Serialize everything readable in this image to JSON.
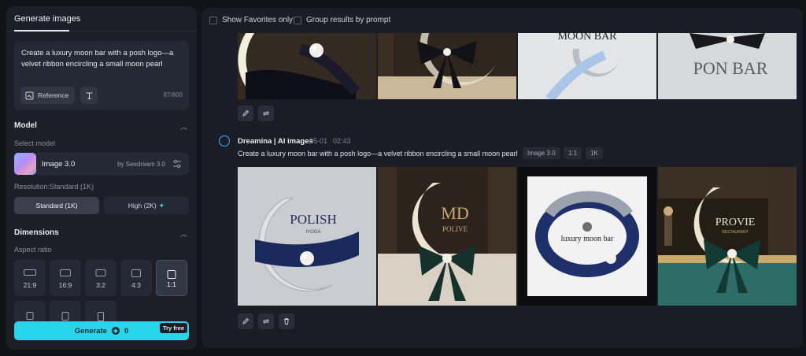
{
  "left_panel": {
    "tab_label": "Generate images",
    "prompt_text": "Create a luxury moon bar with a posh logo—a velvet ribbon encircling a small moon pearl",
    "reference_label": "Reference",
    "char_count": "87/800",
    "model_section": {
      "title": "Model",
      "select_label": "Select model",
      "model_name": "Image 3.0",
      "model_by": "by Seedream 3.0"
    },
    "resolution": {
      "label": "Resolution:Standard (1K)",
      "standard_label": "Standard (1K)",
      "high_label": "High (2K)"
    },
    "dimensions": {
      "title": "Dimensions",
      "aspect_label": "Aspect ratio",
      "ratios": [
        "21:9",
        "16:9",
        "3:2",
        "4:3",
        "1:1"
      ],
      "selected": "1:1"
    },
    "generate": {
      "label": "Generate",
      "cost": "0",
      "badge": "Try free"
    }
  },
  "right_panel": {
    "filters": {
      "favorites_label": "Show Favorites only",
      "group_label": "Group results by prompt"
    },
    "top_row_texts": {
      "moon_bar_text": "MOON BAR",
      "pon_bar_text": "PON BAR"
    },
    "generation": {
      "source": "Dreamina | AI images",
      "date": "05-01",
      "time": "02:43",
      "prompt": "Create a luxury moon bar with a posh logo—a velvet ribbon encircling a small moon pearl",
      "chips": [
        "Image 3.0",
        "1:1",
        "1K"
      ]
    },
    "images": {
      "polish_title": "POLISH",
      "polish_sub": "IYOGA",
      "polive_mono": "MD",
      "polive_title": "POLIVE",
      "luxury_title": "luxury moon bar",
      "provie_title": "PROVIE",
      "provie_sub": "RESTAURANT"
    }
  },
  "colors": {
    "accent": "#27d6ea",
    "panel": "#1c1f27",
    "background": "#111318"
  }
}
